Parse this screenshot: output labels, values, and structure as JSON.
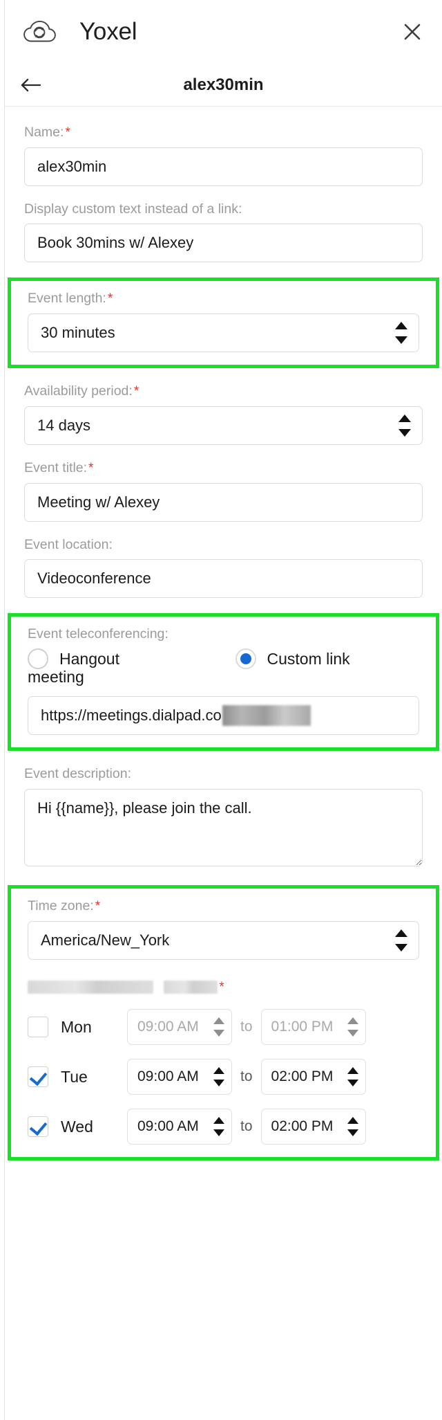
{
  "app": {
    "title": "Yoxel",
    "logo_icon": "cloud-sync-icon",
    "close_icon": "close-icon"
  },
  "subheader": {
    "back_icon": "arrow-left-icon",
    "title": "alex30min"
  },
  "colors": {
    "highlight": "#18e026",
    "required": "#e4342c",
    "radio_selected": "#1769d4",
    "checkbox_check": "#1769d4",
    "label_gray": "#9b9b9b"
  },
  "form": {
    "name": {
      "label": "Name:",
      "required": true,
      "value": "alex30min"
    },
    "display_text": {
      "label": "Display custom text instead of a link:",
      "required": false,
      "value": "Book 30mins w/ Alexey"
    },
    "event_length": {
      "label": "Event length:",
      "required": true,
      "value": "30 minutes",
      "highlighted": true
    },
    "availability_period": {
      "label": "Availability period:",
      "required": true,
      "value": "14 days",
      "highlighted": false
    },
    "event_title": {
      "label": "Event title:",
      "required": true,
      "value": "Meeting w/ Alexey"
    },
    "event_location": {
      "label": "Event location:",
      "required": false,
      "value": "Videoconference"
    },
    "teleconferencing": {
      "label": "Event teleconferencing:",
      "required": false,
      "highlighted": true,
      "options": [
        {
          "label": "Hangout meeting",
          "selected": false
        },
        {
          "label": "Custom link",
          "selected": true
        }
      ],
      "custom_link_value": "https://meetings.dialpad.co",
      "custom_link_redacted": true
    },
    "event_description": {
      "label": "Event description:",
      "required": false,
      "value": "Hi {{name}}, please join the call."
    },
    "time_zone": {
      "label": "Time zone:",
      "required": true,
      "value": "America/New_York",
      "highlighted": true
    },
    "availability_hours": {
      "label_redacted": true,
      "required": true,
      "to_label": "to",
      "rows": [
        {
          "day": "Mon",
          "checked": false,
          "enabled": false,
          "start": "09:00 AM",
          "end": "01:00 PM"
        },
        {
          "day": "Tue",
          "checked": true,
          "enabled": true,
          "start": "09:00 AM",
          "end": "02:00 PM"
        },
        {
          "day": "Wed",
          "checked": true,
          "enabled": true,
          "start": "09:00 AM",
          "end": "02:00 PM"
        }
      ]
    }
  }
}
